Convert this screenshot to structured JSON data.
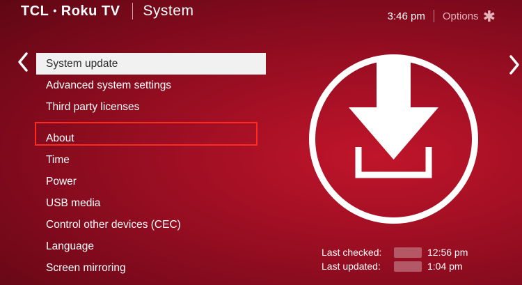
{
  "header": {
    "brand_tcl": "TCL",
    "brand_dot": "•",
    "brand_roku": "Roku TV",
    "section": "System",
    "time": "3:46 pm",
    "options_label": "Options",
    "options_icon": "asterisk-icon"
  },
  "nav": {
    "left_icon": "chevron-left-icon",
    "right_icon": "chevron-right-icon"
  },
  "menu": {
    "items": [
      {
        "label": "System update"
      },
      {
        "label": "Advanced system settings"
      },
      {
        "label": "Third party licenses"
      },
      {
        "label": "About"
      },
      {
        "label": "Time"
      },
      {
        "label": "Power"
      },
      {
        "label": "USB media"
      },
      {
        "label": "Control other devices (CEC)"
      },
      {
        "label": "Language"
      },
      {
        "label": "Screen mirroring"
      }
    ],
    "selected": "System update",
    "highlighted": "About"
  },
  "panel": {
    "icon": "download-icon",
    "last_checked_label": "Last checked:",
    "last_checked_time": "12:56 pm",
    "last_updated_label": "Last updated:",
    "last_updated_time": "1:04 pm"
  },
  "colors": {
    "background": "#a10f24",
    "highlight_border": "#ff2a1f",
    "selected_bg": "#f1f1f1"
  }
}
